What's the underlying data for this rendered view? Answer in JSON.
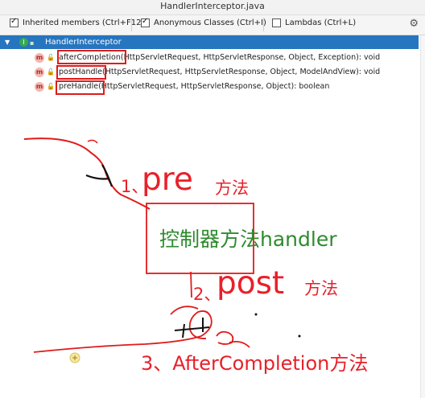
{
  "window": {
    "title": "HandlerInterceptor.java"
  },
  "toolbar": {
    "inherited": {
      "label": "Inherited members (Ctrl+F12)",
      "checked": true
    },
    "anonymous": {
      "label": "Anonymous Classes (Ctrl+I)",
      "checked": true
    },
    "lambdas": {
      "label": "Lambdas (Ctrl+L)",
      "checked": false
    },
    "settings_icon": "gear-icon"
  },
  "tree": {
    "root": {
      "label": "HandlerInterceptor",
      "icon": "interface-icon"
    },
    "members": [
      {
        "name": "afterCompletion",
        "signature": "afterCompletion(HttpServletRequest, HttpServletResponse, Object, Exception): void",
        "icon": "method-icon"
      },
      {
        "name": "postHandle",
        "signature": "postHandle(HttpServletRequest, HttpServletResponse, Object, ModelAndView): void",
        "icon": "method-icon"
      },
      {
        "name": "preHandle",
        "signature": "preHandle(HttpServletRequest, HttpServletResponse, Object): boolean",
        "icon": "method-icon"
      }
    ]
  },
  "annotations": {
    "step1_num": "1、",
    "step1_word": "pre",
    "step1_suffix": "方法",
    "controller": "控制器方法handler",
    "step2_num": "2、",
    "step2_word": "post",
    "step2_suffix": "方法",
    "step3": "3、AfterCompletion方法"
  },
  "colors": {
    "annotation": "#e8202a",
    "controller_text": "#2e8b2e",
    "selection": "#2675bf"
  }
}
